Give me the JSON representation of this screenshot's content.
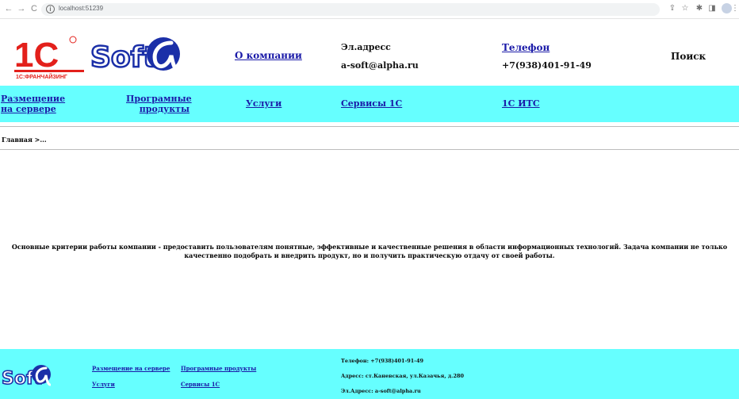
{
  "browser": {
    "url": "localhost:51239",
    "icons": [
      "back-icon",
      "forward-icon",
      "reload-icon",
      "info-icon",
      "share-icon",
      "star-icon",
      "extensions-icon",
      "sidebar-icon",
      "profile-icon",
      "more-icon"
    ]
  },
  "header": {
    "logo_1c_text": "1C",
    "logo_1c_caption": "1С:ФРАНЧАЙЗИНГ",
    "logo_soft_text": "Soft",
    "about_link": "О компании",
    "email_label": "Эл.адресс",
    "email_value": "a-soft@alpha.ru",
    "phone_link": "Телефон",
    "phone_value": "+7(938)401-91-49",
    "search_label": "Поиск"
  },
  "nav": {
    "items": [
      {
        "label": "Размещение на сервере"
      },
      {
        "label": "Програмные продукты"
      },
      {
        "label": "Услуги"
      },
      {
        "label": "Сервисы 1С"
      },
      {
        "label": "1С ИТС"
      }
    ]
  },
  "breadcrumb": "Главная >...",
  "intro": "Основные критерии работы компании - предоставить пользователям понятные, эффективные и качественные решения в области информационных технологий. Задача компании не только качественно подобрать и внедрить продукт, но и получить практическую отдачу от своей работы.",
  "footer": {
    "logo_text": "Soft",
    "links": [
      {
        "label": "Размещение на сервере"
      },
      {
        "label": "Програмные продукты"
      },
      {
        "label": "Услуги"
      },
      {
        "label": "Сервисы 1С"
      }
    ],
    "phone": "Телефон: +7(938)401-91-49",
    "address": "Адресс: ст.Каневская, ул.Казачья, д.280",
    "email": "Эл.Адресс: a-soft@alpha.ru"
  },
  "colors": {
    "cyan_bar": "#66ffff",
    "link": "#1a1aa8",
    "logo_red": "#e3201b",
    "logo_blue": "#1b2fa8"
  }
}
